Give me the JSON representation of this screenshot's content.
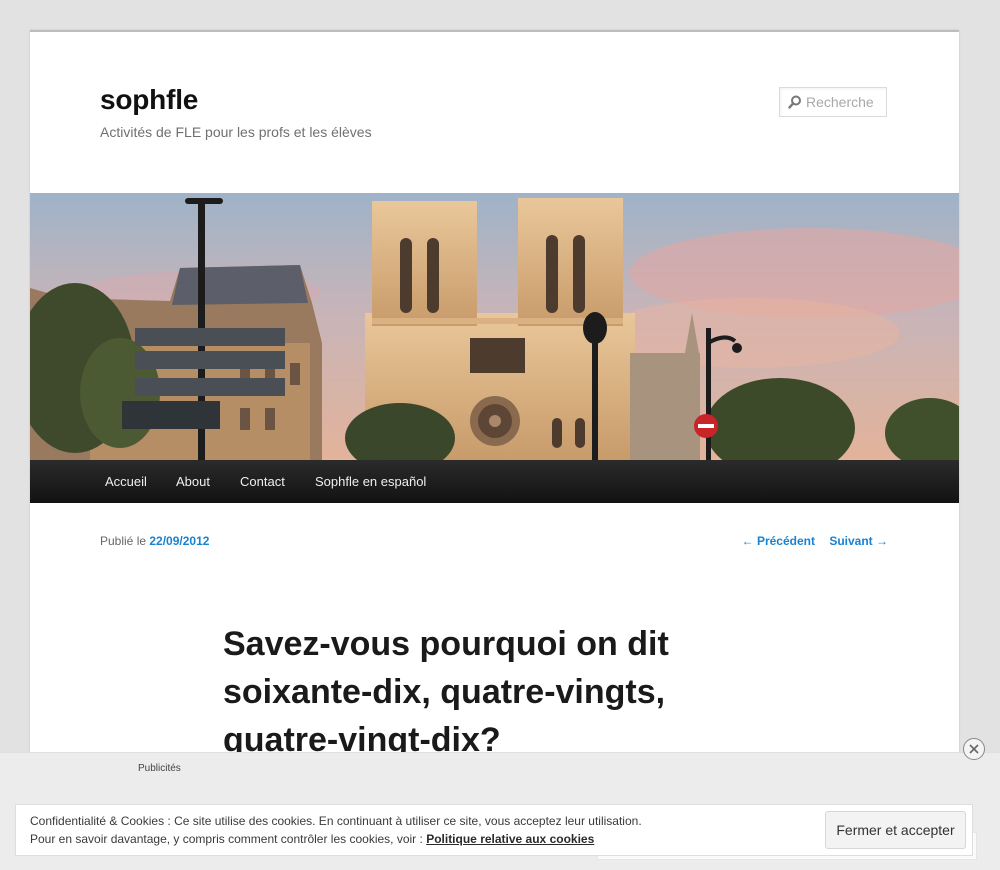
{
  "site": {
    "title": "sophfle",
    "description": "Activités de FLE pour les profs et les élèves"
  },
  "search": {
    "placeholder": "Recherche"
  },
  "banner": {
    "subject": "Notre-Dame de Paris au coucher du soleil"
  },
  "nav": {
    "items": [
      {
        "label": "Accueil"
      },
      {
        "label": "About"
      },
      {
        "label": "Contact"
      },
      {
        "label": "Sophfle en español"
      }
    ]
  },
  "post": {
    "published_prefix": "Publié le",
    "date": "22/09/2012",
    "prev": "← Précédent",
    "next": "Suivant →",
    "title": "Savez-vous pourquoi on dit soixante-dix, quatre-vingts, quatre-vingt-dix?"
  },
  "ads": {
    "label": "Publicités"
  },
  "cookie": {
    "line1": "Confidentialité & Cookies : Ce site utilise des cookies. En continuant à utiliser ce site, vous acceptez leur utilisation.",
    "line2_prefix": "Pour en savoir davantage, y compris comment contrôler les cookies, voir :",
    "policy_link": "Politique relative aux cookies",
    "accept_button": "Fermer et accepter"
  },
  "colors": {
    "link": "#1982d1",
    "nav_bg": "#1a1a1a",
    "page_bg": "#e2e2e2"
  }
}
